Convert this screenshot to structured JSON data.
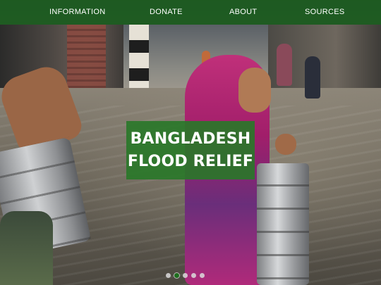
{
  "nav": {
    "items": [
      {
        "label": "INFORMATION"
      },
      {
        "label": "DONATE"
      },
      {
        "label": "ABOUT"
      },
      {
        "label": "SOURCES"
      }
    ]
  },
  "hero": {
    "title_line1": "BANGLADESH",
    "title_line2": "FLOOD RELIEF",
    "image_semantic": "flooded-street-girl-carrying-tiffin-boxes"
  },
  "carousel": {
    "slide_count": 5,
    "active_index": 1
  },
  "colors": {
    "nav_bg": "#185c1c",
    "headline_bg": "#287828",
    "text": "#ffffff",
    "active_dot": "#1e6e1e"
  }
}
